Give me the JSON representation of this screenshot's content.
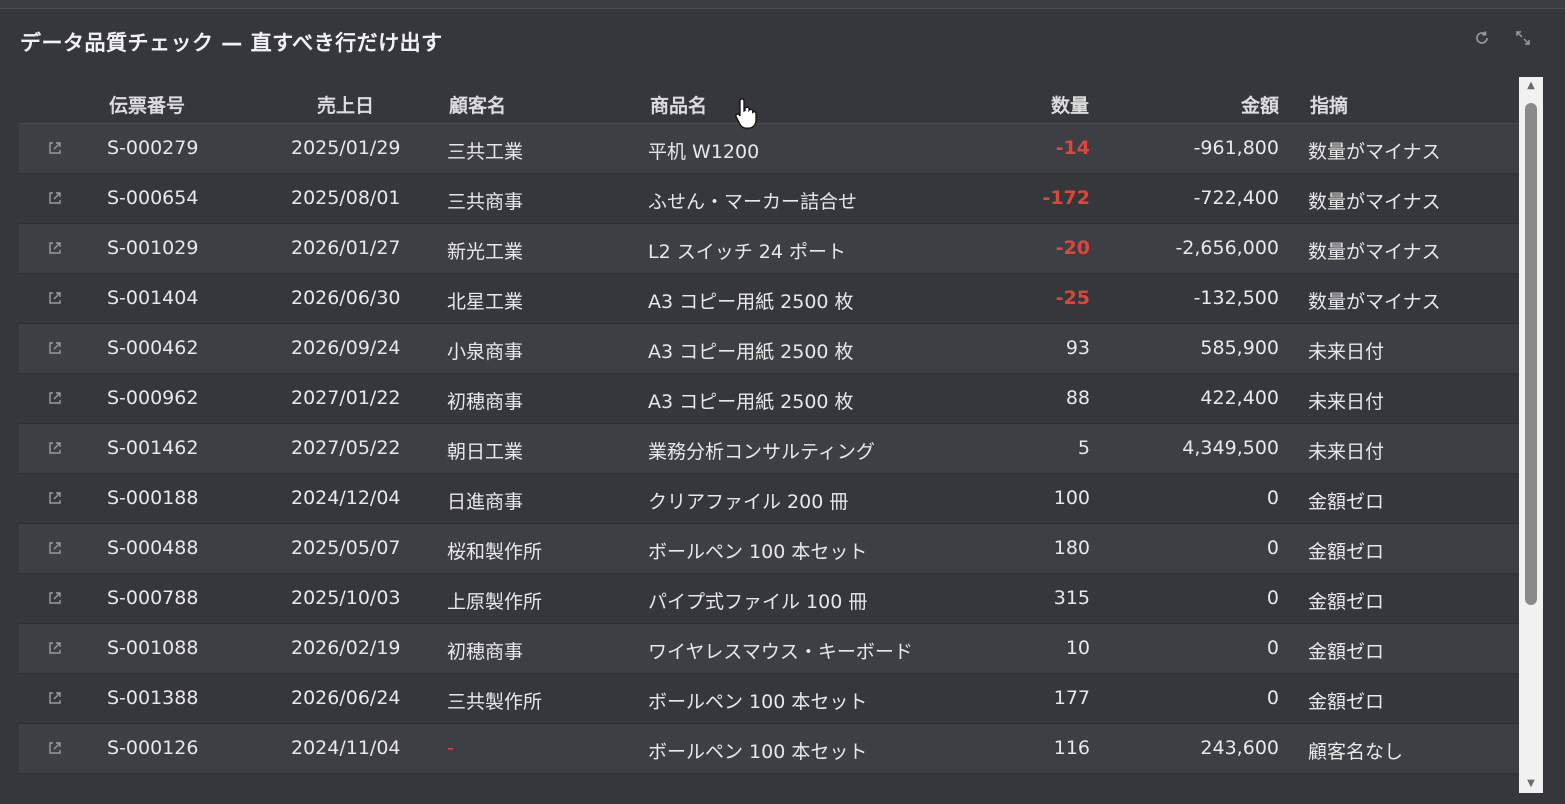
{
  "dialog": {
    "title": "データ品質チェック — 直すべき行だけ出す",
    "refresh_icon": "refresh-icon",
    "expand_icon": "expand-icon"
  },
  "columns": {
    "id": "伝票番号",
    "date": "売上日",
    "customer": "顧客名",
    "product": "商品名",
    "qty": "数量",
    "amount": "金額",
    "note": "指摘"
  },
  "rows": [
    {
      "id": "S-000279",
      "date": "2025/01/29",
      "customer": "三共工業",
      "product": "平机 W1200",
      "qty": "-14",
      "amount": "-961,800",
      "note": "数量がマイナス",
      "qty_negative": true
    },
    {
      "id": "S-000654",
      "date": "2025/08/01",
      "customer": "三共商事",
      "product": "ふせん・マーカー詰合せ",
      "qty": "-172",
      "amount": "-722,400",
      "note": "数量がマイナス",
      "qty_negative": true
    },
    {
      "id": "S-001029",
      "date": "2026/01/27",
      "customer": "新光工業",
      "product": "L2 スイッチ 24 ポート",
      "qty": "-20",
      "amount": "-2,656,000",
      "note": "数量がマイナス",
      "qty_negative": true
    },
    {
      "id": "S-001404",
      "date": "2026/06/30",
      "customer": "北星工業",
      "product": "A3 コピー用紙 2500 枚",
      "qty": "-25",
      "amount": "-132,500",
      "note": "数量がマイナス",
      "qty_negative": true
    },
    {
      "id": "S-000462",
      "date": "2026/09/24",
      "customer": "小泉商事",
      "product": "A3 コピー用紙 2500 枚",
      "qty": "93",
      "amount": "585,900",
      "note": "未来日付",
      "qty_negative": false
    },
    {
      "id": "S-000962",
      "date": "2027/01/22",
      "customer": "初穂商事",
      "product": "A3 コピー用紙 2500 枚",
      "qty": "88",
      "amount": "422,400",
      "note": "未来日付",
      "qty_negative": false
    },
    {
      "id": "S-001462",
      "date": "2027/05/22",
      "customer": "朝日工業",
      "product": "業務分析コンサルティング",
      "qty": "5",
      "amount": "4,349,500",
      "note": "未来日付",
      "qty_negative": false
    },
    {
      "id": "S-000188",
      "date": "2024/12/04",
      "customer": "日進商事",
      "product": "クリアファイル 200 冊",
      "qty": "100",
      "amount": "0",
      "note": "金額ゼロ",
      "qty_negative": false
    },
    {
      "id": "S-000488",
      "date": "2025/05/07",
      "customer": "桜和製作所",
      "product": "ボールペン 100 本セット",
      "qty": "180",
      "amount": "0",
      "note": "金額ゼロ",
      "qty_negative": false
    },
    {
      "id": "S-000788",
      "date": "2025/10/03",
      "customer": "上原製作所",
      "product": "パイプ式ファイル 100 冊",
      "qty": "315",
      "amount": "0",
      "note": "金額ゼロ",
      "qty_negative": false
    },
    {
      "id": "S-001088",
      "date": "2026/02/19",
      "customer": "初穂商事",
      "product": "ワイヤレスマウス・キーボード",
      "qty": "10",
      "amount": "0",
      "note": "金額ゼロ",
      "qty_negative": false
    },
    {
      "id": "S-001388",
      "date": "2026/06/24",
      "customer": "三共製作所",
      "product": "ボールペン 100 本セット",
      "qty": "177",
      "amount": "0",
      "note": "金額ゼロ",
      "qty_negative": false
    },
    {
      "id": "S-000126",
      "date": "2024/11/04",
      "customer": "-",
      "product": "ボールペン 100 本セット",
      "qty": "116",
      "amount": "243,600",
      "note": "顧客名なし",
      "qty_negative": false,
      "customer_missing": true
    }
  ],
  "colors": {
    "negative": "#e0453a",
    "row_odd": "#3d3f44",
    "row_even": "#35373b"
  }
}
